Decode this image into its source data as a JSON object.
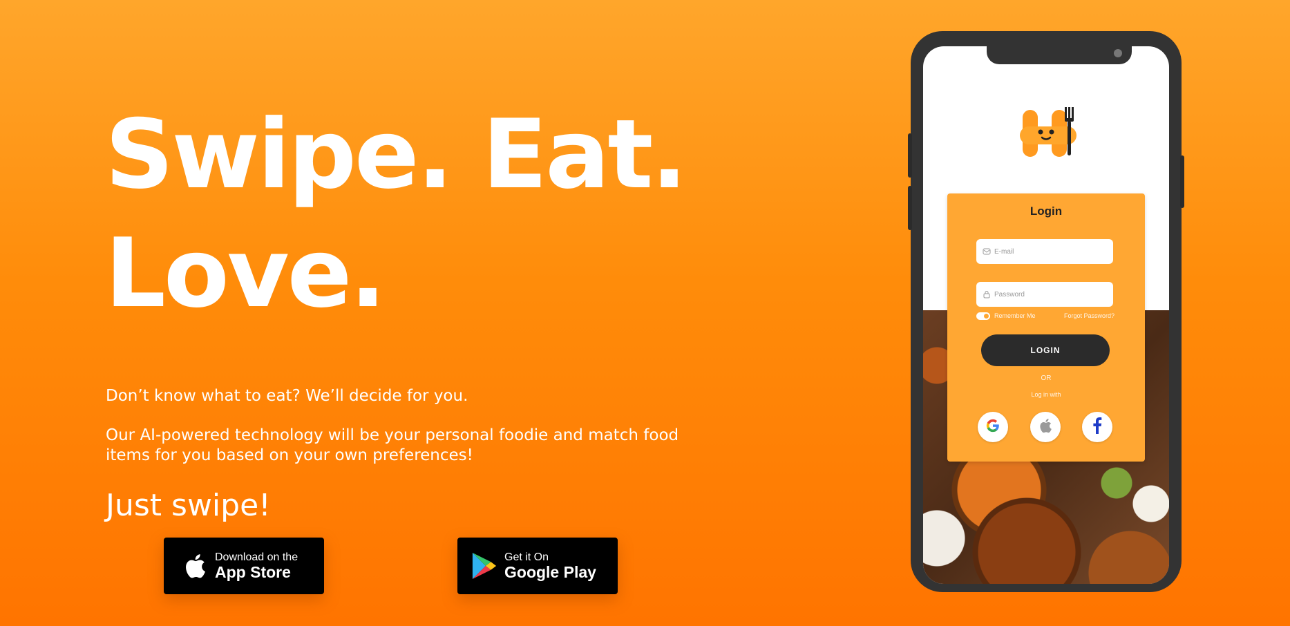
{
  "hero": {
    "headline_line1": "Swipe. Eat.",
    "headline_line2": "Love.",
    "tagline": "Don’t know what to eat? We’ll decide for you.",
    "description": "Our AI-powered technology will be your personal foodie and match food items for you based on your own preferences!",
    "cta": "Just swipe!"
  },
  "stores": {
    "apple": {
      "small": "Download on the",
      "big": "App Store",
      "icon": "apple-icon"
    },
    "google": {
      "small": "Get it On",
      "big": "Google Play",
      "icon": "google-play-icon"
    }
  },
  "phone": {
    "login": {
      "title": "Login",
      "email_placeholder": "E-mail",
      "password_placeholder": "Password",
      "remember_label": "Remember Me",
      "forgot_label": "Forgot Password?",
      "login_button": "LOGIN",
      "or_text": "OR",
      "login_with": "Log in with",
      "social": [
        "google-icon",
        "apple-icon",
        "facebook-icon"
      ]
    }
  },
  "colors": {
    "accent": "#ff8c0a",
    "card": "#ffa733",
    "dark": "#2b2b2b"
  }
}
